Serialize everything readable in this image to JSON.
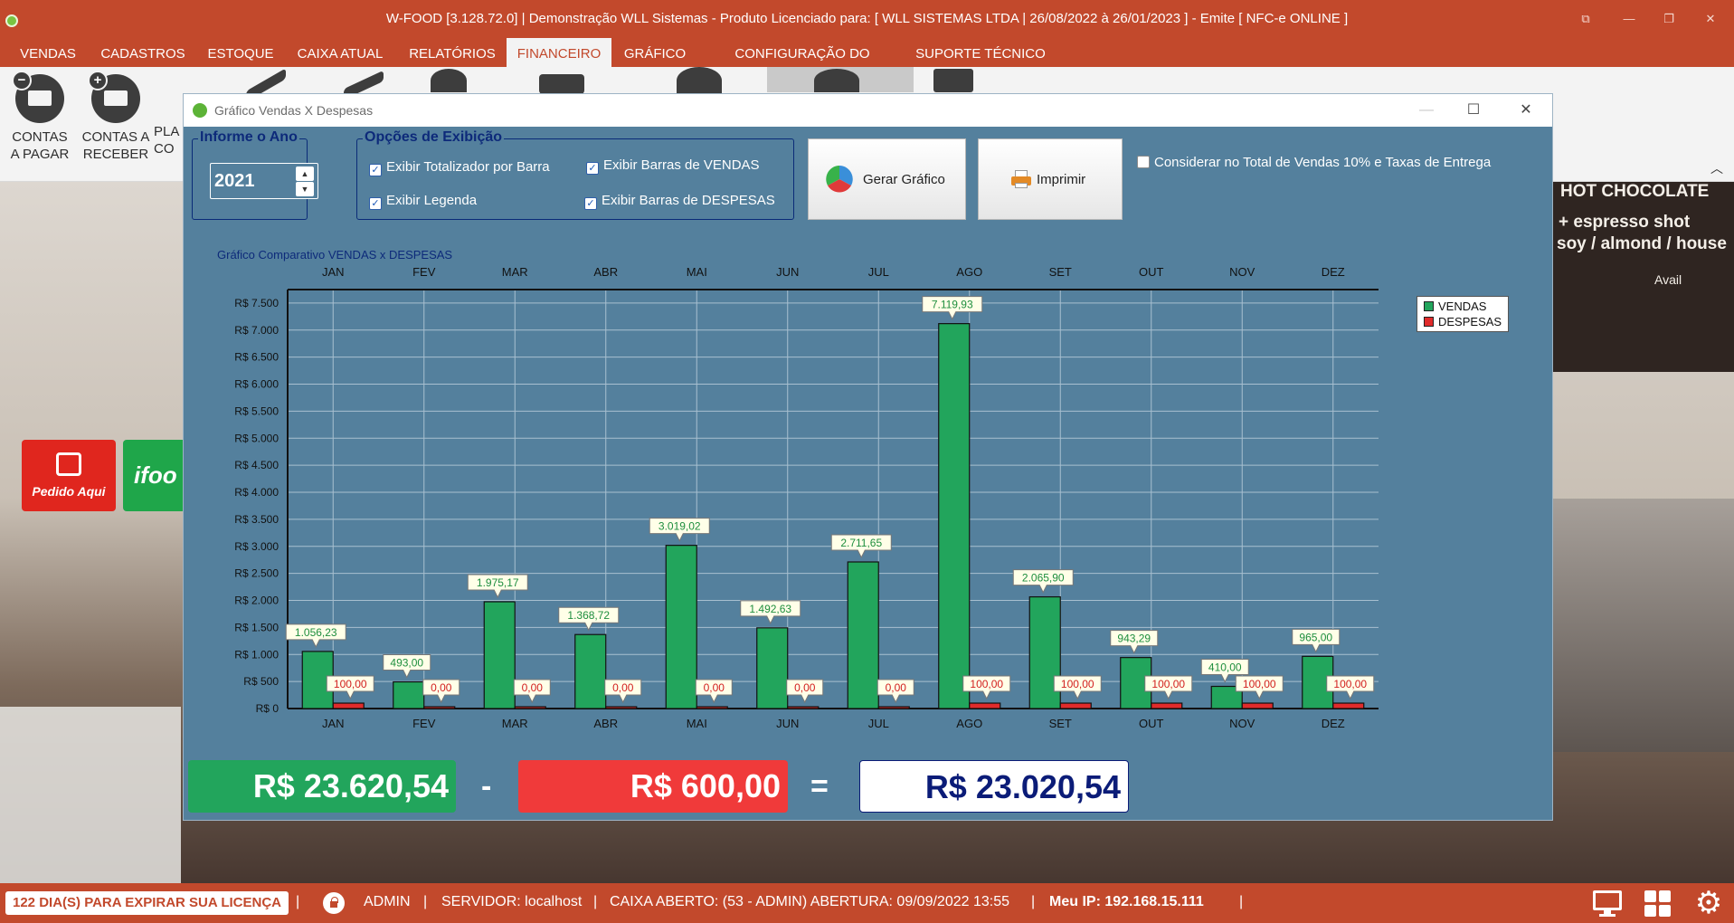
{
  "app": {
    "title": "W-FOOD [3.128.72.0] | Demonstração WLL Sistemas - Produto Licenciado para:  [ WLL SISTEMAS LTDA | 26/08/2022 à 26/01/2023 ]  - Emite [ NFC-e ONLINE ]",
    "window_controls": [
      "⧉",
      "—",
      "❐",
      "✕"
    ]
  },
  "menu": [
    "VENDAS",
    "CADASTROS",
    "ESTOQUE",
    "CAIXA ATUAL",
    "RELATÓRIOS",
    "FINANCEIRO",
    "GRÁFICO",
    "CONFIGURAÇÃO DO SISTEMA",
    "SUPORTE TÉCNICO"
  ],
  "active_menu": "FINANCEIRO",
  "ribbon": {
    "contas_pagar": {
      "line1": "CONTAS",
      "line2": "A PAGAR"
    },
    "contas_receber": {
      "line1": "CONTAS A",
      "line2": "RECEBER"
    },
    "partial_label": {
      "line1": "PLA",
      "line2": "CO"
    }
  },
  "background": {
    "tiles": [
      {
        "label": "Pedido Aqui",
        "color": "#e0261e"
      },
      {
        "label": "ifoo",
        "color": "#1fa64a"
      }
    ],
    "board_lines": [
      "HOT CHOCOLATE",
      "+ espresso shot",
      "soy / almond / house",
      "Avail"
    ]
  },
  "dialog": {
    "title": "Gráfico Vendas X Despesas",
    "year_group": {
      "title": "Informe o Ano",
      "value": "2021"
    },
    "options_group": {
      "title": "Opções de Exibição",
      "show_bar_totals": "Exibir Totalizador por Barra",
      "show_legend": "Exibir Legenda",
      "show_sales_bars": "Exibir Barras de VENDAS",
      "show_expense_bars": "Exibir Barras de DESPESAS"
    },
    "generate_button": "Gerar Gráfico",
    "print_button": "Imprimir",
    "consider_fee": "Considerar no Total de Vendas 10% e Taxas de Entrega"
  },
  "chart_data": {
    "type": "bar",
    "title": "Gráfico Comparativo VENDAS x DESPESAS",
    "categories": [
      "JAN",
      "FEV",
      "MAR",
      "ABR",
      "MAI",
      "JUN",
      "JUL",
      "AGO",
      "SET",
      "OUT",
      "NOV",
      "DEZ"
    ],
    "series": [
      {
        "name": "VENDAS",
        "color": "#22a55c",
        "values": [
          1056.23,
          493.0,
          1975.17,
          1368.72,
          3019.02,
          1492.63,
          2711.65,
          7119.93,
          2065.9,
          943.29,
          410.0,
          965.0
        ],
        "labels": [
          "1.056,23",
          "493,00",
          "1.975,17",
          "1.368,72",
          "3.019,02",
          "1.492,63",
          "2.711,65",
          "7.119,93",
          "2.065,90",
          "943,29",
          "410,00",
          "965,00"
        ]
      },
      {
        "name": "DESPESAS",
        "color": "#e02b2b",
        "values": [
          100,
          0,
          0,
          0,
          0,
          0,
          0,
          100,
          100,
          100,
          100,
          100
        ],
        "labels": [
          "100,00",
          "0,00",
          "0,00",
          "0,00",
          "0,00",
          "0,00",
          "0,00",
          "100,00",
          "100,00",
          "100,00",
          "100,00",
          "100,00"
        ]
      }
    ],
    "ylim": [
      0,
      7750
    ],
    "y_ticks": [
      {
        "value": 0,
        "label": "R$ 0"
      },
      {
        "value": 500,
        "label": "R$ 500"
      },
      {
        "value": 1000,
        "label": "R$ 1.000"
      },
      {
        "value": 1500,
        "label": "R$ 1.500"
      },
      {
        "value": 2000,
        "label": "R$ 2.000"
      },
      {
        "value": 2500,
        "label": "R$ 2.500"
      },
      {
        "value": 3000,
        "label": "R$ 3.000"
      },
      {
        "value": 3500,
        "label": "R$ 3.500"
      },
      {
        "value": 4000,
        "label": "R$ 4.000"
      },
      {
        "value": 4500,
        "label": "R$ 4.500"
      },
      {
        "value": 5000,
        "label": "R$ 5.000"
      },
      {
        "value": 5500,
        "label": "R$ 5.500"
      },
      {
        "value": 6000,
        "label": "R$ 6.000"
      },
      {
        "value": 6500,
        "label": "R$ 6.500"
      },
      {
        "value": 7000,
        "label": "R$ 7.000"
      },
      {
        "value": 7500,
        "label": "R$ 7.500"
      }
    ],
    "grid": true,
    "legend": "top-right"
  },
  "totals": {
    "sales": "R$ 23.620,54",
    "minus": "-",
    "expenses": "R$ 600,00",
    "equals": "=",
    "result": "R$ 23.020,54"
  },
  "statusbar": {
    "license": "122 DIA(S) PARA EXPIRAR SUA LICENÇA",
    "sep": "|",
    "user": "ADMIN",
    "server": "SERVIDOR: localhost",
    "cashier": "CAIXA ABERTO: (53 - ADMIN) ABERTURA: 09/09/2022 13:55",
    "ip": "Meu IP: 192.168.15.111"
  },
  "colors": {
    "brand": "#c2492c",
    "panel": "#54809d",
    "sales_total": "#22a55c",
    "expense_total": "#f03a3a",
    "result_text": "#0b1c78"
  }
}
